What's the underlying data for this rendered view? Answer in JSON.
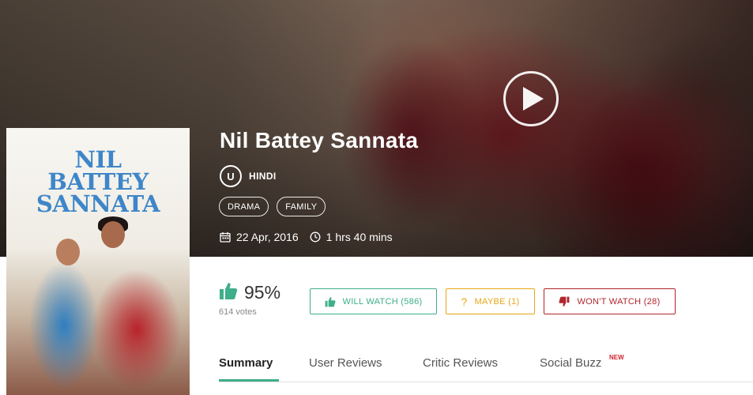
{
  "movie": {
    "title": "Nil Battey Sannata",
    "certificate": "U",
    "language": "HINDI",
    "genres": [
      "DRAMA",
      "FAMILY"
    ],
    "release_date": "22 Apr, 2016",
    "duration": "1 hrs 40 mins"
  },
  "poster": {
    "title_lines": [
      "NIL",
      "BATTEY",
      "SANNATA"
    ]
  },
  "rating": {
    "percent": "95%",
    "votes": "614 votes"
  },
  "actions": {
    "will_watch": "WILL WATCH (586)",
    "maybe": "MAYBE (1)",
    "wont_watch": "WON'T WATCH (28)",
    "maybe_symbol": "?"
  },
  "tabs": [
    {
      "label": "Summary",
      "active": true
    },
    {
      "label": "User Reviews",
      "active": false
    },
    {
      "label": "Critic Reviews",
      "active": false
    },
    {
      "label": "Social Buzz",
      "active": false
    }
  ],
  "new_badge": "NEW",
  "colors": {
    "green": "#3fae8a",
    "amber": "#e8a717",
    "red": "#b0252d"
  },
  "icons": [
    "play-icon",
    "calendar-icon",
    "clock-icon",
    "thumbs-up-icon",
    "question-icon",
    "thumbs-down-icon"
  ]
}
